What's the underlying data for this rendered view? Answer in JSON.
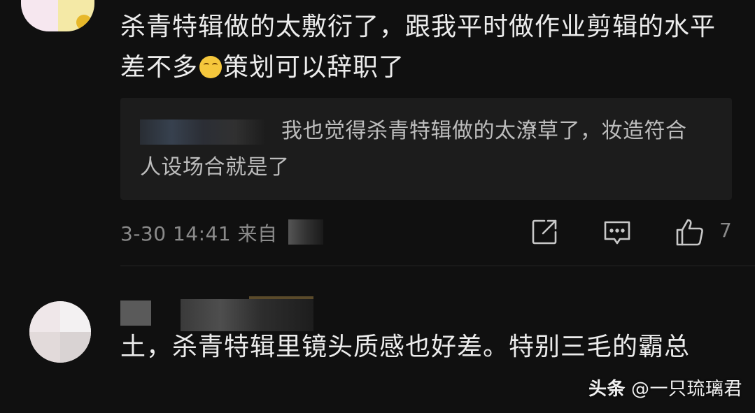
{
  "comment1": {
    "text_before_emoji": "杀青特辑做的太敷衍了，跟我平时做作业剪辑的水平差不多",
    "emoji": "crying-laughing-emoji",
    "text_after_emoji": "策划可以辞职了",
    "reply": {
      "text": "我也觉得杀青特辑做的太潦草了，妆造符合人设场合就是了"
    },
    "meta": {
      "time": "3-30 14:41",
      "source_prefix": "来自"
    },
    "like_count": "7"
  },
  "comment2": {
    "text": "土，杀青特辑里镜头质感也好差。特别三毛的霸总"
  },
  "watermark": {
    "brand": "头条",
    "handle": "@一只琉璃君"
  },
  "icons": {
    "share": "share-icon",
    "reply": "comment-icon",
    "like": "thumbs-up-icon"
  },
  "colors": {
    "background": "#101010",
    "text": "#ececec",
    "meta": "#8a8a8a",
    "reply_box": "#1c1c1c"
  }
}
